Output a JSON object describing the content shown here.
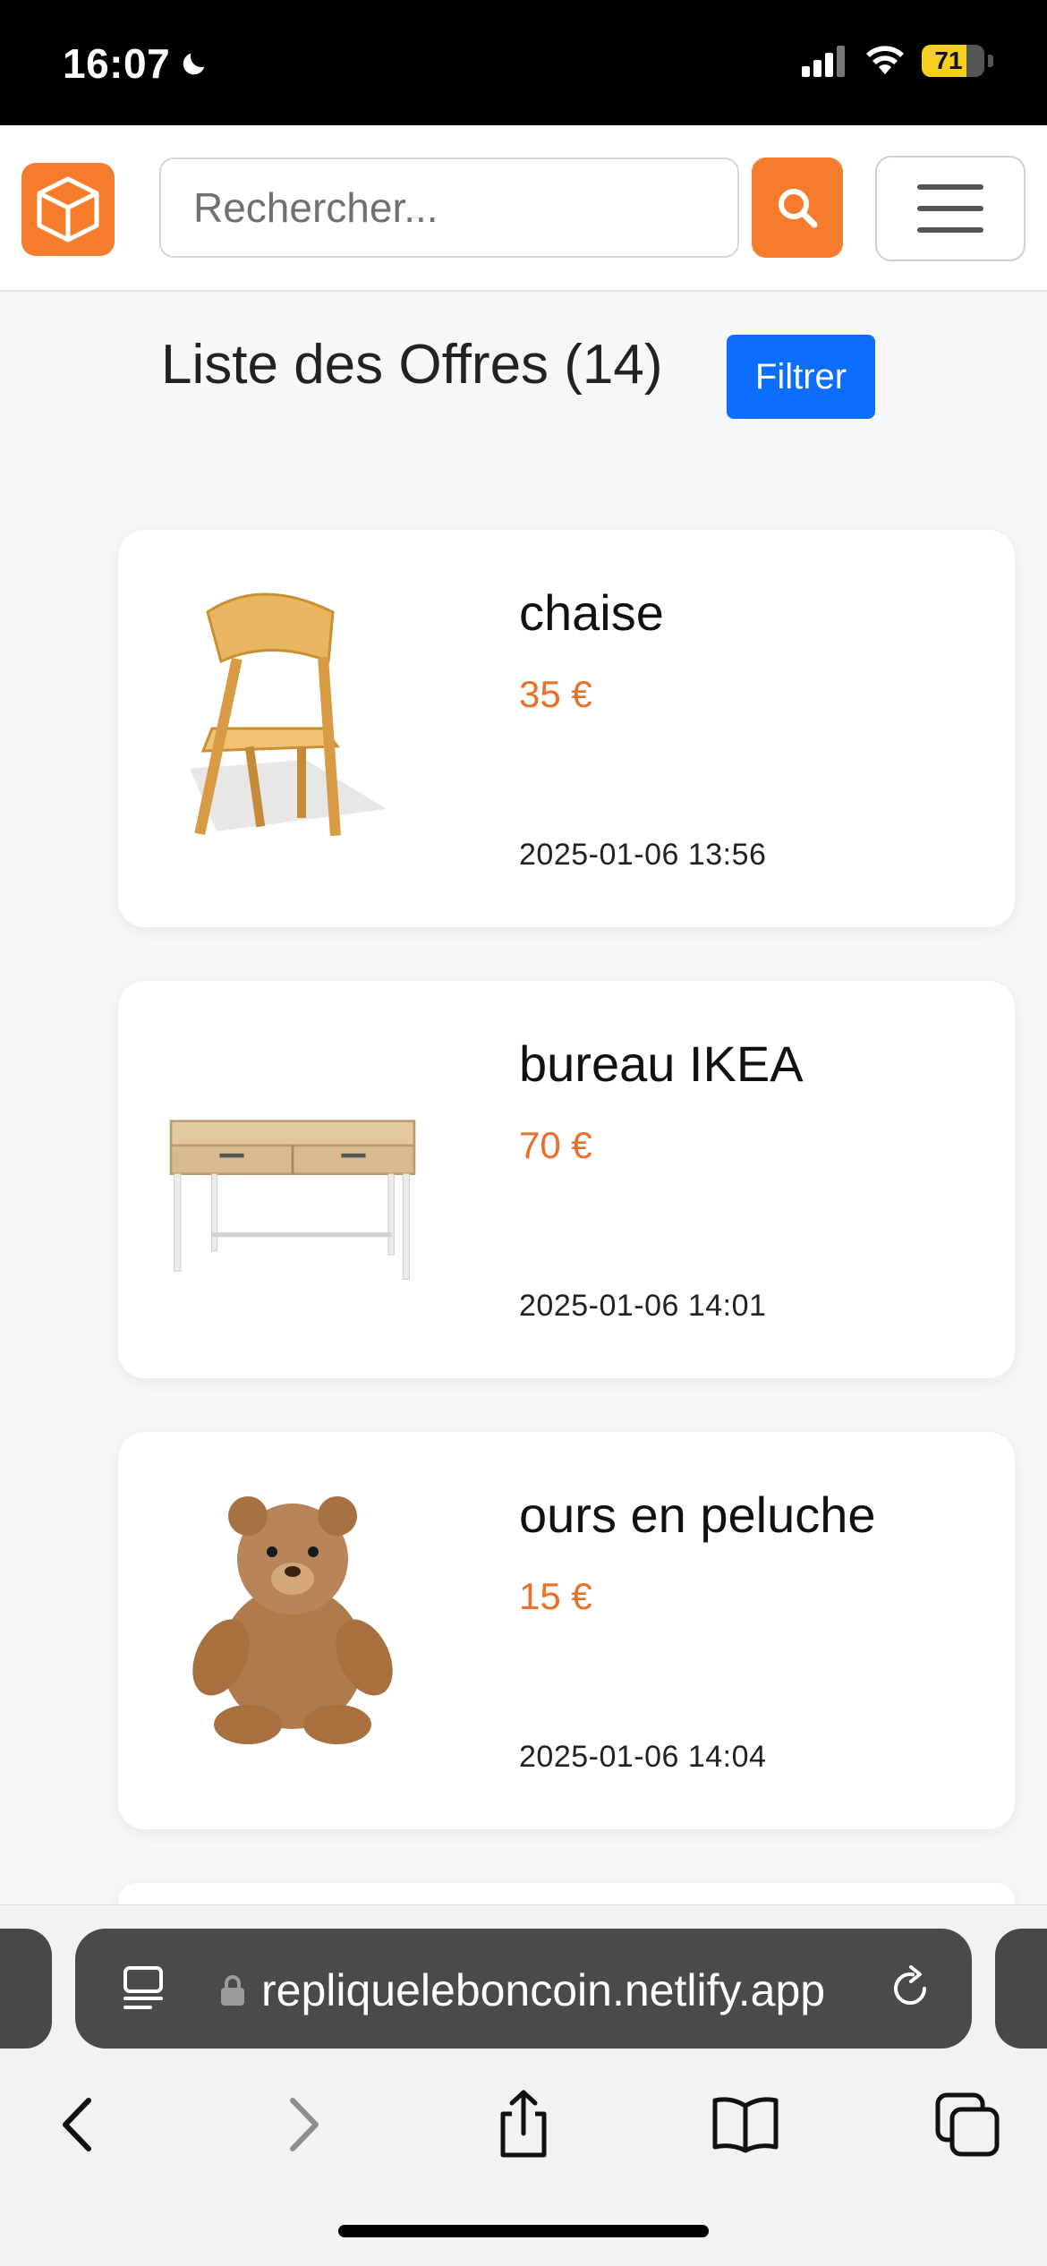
{
  "status_bar": {
    "time": "16:07",
    "battery_level": "71"
  },
  "header": {
    "search_placeholder": "Rechercher...",
    "icons": [
      "box-logo-icon",
      "search-icon",
      "hamburger-menu-icon"
    ],
    "accent_color": "#f47c2c"
  },
  "listing": {
    "title": "Liste des Offres (14)",
    "filter_label": "Filtrer",
    "filter_color": "#0d6efd"
  },
  "offers": [
    {
      "title": "chaise",
      "price": "35 €",
      "date": "2025-01-06 13:56",
      "image": "wooden-chair"
    },
    {
      "title": "bureau IKEA",
      "price": "70 €",
      "date": "2025-01-06 14:01",
      "image": "desk"
    },
    {
      "title": "ours en peluche",
      "price": "15 €",
      "date": "2025-01-06 14:04",
      "image": "teddy-bear"
    }
  ],
  "browser": {
    "url": "repliqueleboncoin.netlify.app",
    "icons": [
      "page-menu-icon",
      "lock-icon",
      "reload-icon",
      "back-icon",
      "forward-icon",
      "share-icon",
      "bookmarks-icon",
      "tabs-icon"
    ]
  }
}
